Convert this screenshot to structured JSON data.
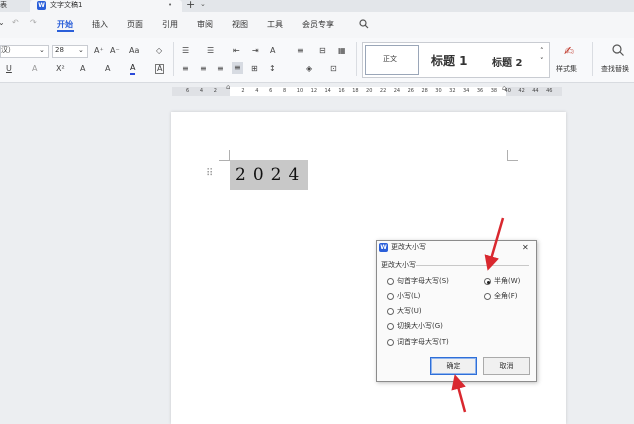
{
  "tabbar": {
    "left_tab_label": "表",
    "doc_tab_label": "文字文稿1",
    "doc_tab_modified": "•",
    "new_tab": "+",
    "dropdown": "⌄",
    "doc_icon": "W"
  },
  "menubar": {
    "items": [
      "开始",
      "插入",
      "页面",
      "引用",
      "审阅",
      "视图",
      "工具",
      "会员专享"
    ],
    "active": "开始",
    "undo": "↶",
    "redo": "↷",
    "more": "⌄"
  },
  "ribbon": {
    "font_name": "汉）",
    "font_size": "28",
    "style_normal": "正文",
    "style_h1": "标题 1",
    "style_h2": "标题 2",
    "styles_set_label": "样式集",
    "find_replace_label": "查找替换",
    "toggle_icon": "⊡",
    "buttons_row1": [
      "A⁺",
      "A⁻",
      "Aa",
      "◇"
    ],
    "buttons_row2": [
      "U",
      "A",
      "X²",
      "A",
      "A",
      "A",
      "A"
    ],
    "para_row1": [
      "☰",
      "☰",
      "⇤",
      "⇥",
      "A",
      "≡",
      "⊟"
    ],
    "para_row2": [
      "≡",
      "≡",
      "≡",
      "≡",
      "⊞",
      "↕",
      "◈",
      "⊡"
    ]
  },
  "ruler": {
    "ticks": [
      "6",
      "4",
      "2",
      "",
      "2",
      "4",
      "6",
      "8",
      "10",
      "12",
      "14",
      "16",
      "18",
      "20",
      "22",
      "24",
      "26",
      "28",
      "30",
      "32",
      "34",
      "36",
      "38",
      "40",
      "42",
      "44",
      "46"
    ]
  },
  "document": {
    "text": "2024",
    "drag_handle": "⠿"
  },
  "dialog": {
    "app_icon": "W",
    "title": "更改大小写",
    "close": "✕",
    "group_label": "更改大小写",
    "left_options": [
      "句首字母大写(S)",
      "小写(L)",
      "大写(U)",
      "切换大小写(G)",
      "词首字母大写(T)"
    ],
    "right_options": [
      "半角(W)",
      "全角(F)"
    ],
    "selected_right": "半角(W)",
    "ok": "确定",
    "cancel": "取消"
  },
  "colors": {
    "accent": "#2b5fd9",
    "annotation_arrow": "#d9282f",
    "selection": "#c8c8c8"
  }
}
